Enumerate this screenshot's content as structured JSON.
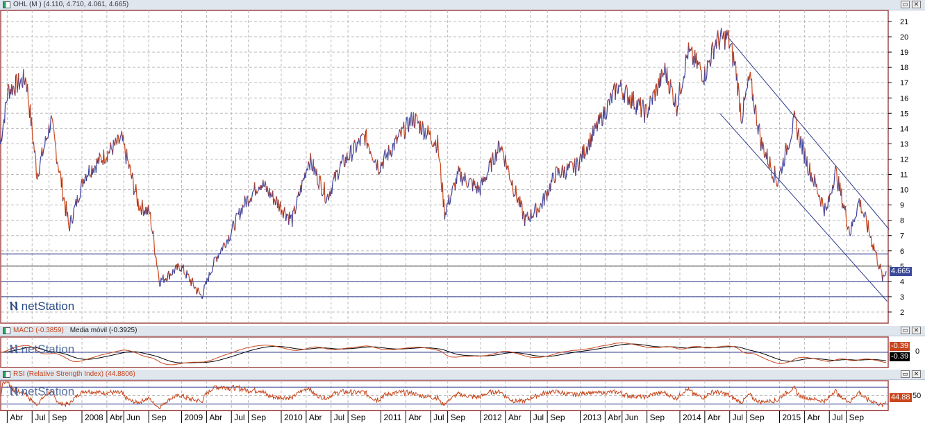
{
  "main_panel": {
    "title": "OHL (M ) (4.110, 4.710, 4.061, 4.665)",
    "last_price": "4.665",
    "y_ticks": [
      "21",
      "20",
      "19",
      "18",
      "17",
      "16",
      "15",
      "14",
      "13",
      "12",
      "11",
      "10",
      "9",
      "8",
      "7",
      "6",
      "5",
      "4",
      "3",
      "2"
    ]
  },
  "macd_panel": {
    "title_macd": "MACD (-0.3859)",
    "separator": " - ",
    "title_ma": "Media móvil (-0.3925)",
    "badge_macd": "-0.39",
    "badge_ma": "-0.39",
    "y_tick": "0"
  },
  "rsi_panel": {
    "title": "RSI (Relative Strength Index) (44.8806)",
    "badge": "44.88",
    "y_tick": "50"
  },
  "watermark": "netStation",
  "x_axis": [
    "Abr",
    "Jul",
    "Sep",
    "2008",
    "Abr",
    "Jun",
    "Sep",
    "2009",
    "Abr",
    "Jul",
    "Sep",
    "2010",
    "Abr",
    "Jul",
    "Sep",
    "2011",
    "Abr",
    "Jul",
    "Sep",
    "2012",
    "Abr",
    "Jul",
    "Sep",
    "2013",
    "Abr",
    "Jun",
    "Sep",
    "2014",
    "Abr",
    "Jul",
    "Sep",
    "2015",
    "Abr",
    "Jul",
    "Sep"
  ],
  "colors": {
    "up": "#3a3f9a",
    "down": "#c8461c",
    "line": "#2e3a8c",
    "border": "#a04848"
  },
  "chart_data": {
    "type": "line",
    "title": "OHL (M)",
    "ylim": [
      2,
      21.5
    ],
    "xlim": [
      2007.18,
      2016.1
    ],
    "x_tick_dates": [
      2007.25,
      2007.5,
      2007.67,
      2008.0,
      2008.25,
      2008.42,
      2008.67,
      2009.0,
      2009.25,
      2009.5,
      2009.67,
      2010.0,
      2010.25,
      2010.5,
      2010.67,
      2011.0,
      2011.25,
      2011.5,
      2011.67,
      2012.0,
      2012.25,
      2012.5,
      2012.67,
      2013.0,
      2013.25,
      2013.42,
      2013.67,
      2014.0,
      2014.25,
      2014.5,
      2014.67,
      2015.0,
      2015.25,
      2015.5,
      2015.67
    ],
    "price_points": [
      [
        2007.18,
        13
      ],
      [
        2007.26,
        16.5
      ],
      [
        2007.44,
        17.3
      ],
      [
        2007.55,
        11
      ],
      [
        2007.69,
        14.5
      ],
      [
        2007.87,
        7.5
      ],
      [
        2008.03,
        11
      ],
      [
        2008.4,
        13.3
      ],
      [
        2008.57,
        9
      ],
      [
        2008.68,
        8.5
      ],
      [
        2008.78,
        4
      ],
      [
        2008.99,
        5
      ],
      [
        2009.2,
        3
      ],
      [
        2009.34,
        5.5
      ],
      [
        2009.48,
        7
      ],
      [
        2009.62,
        9
      ],
      [
        2009.79,
        10.5
      ],
      [
        2010.11,
        8
      ],
      [
        2010.28,
        12
      ],
      [
        2010.46,
        9.5
      ],
      [
        2010.59,
        11.5
      ],
      [
        2010.84,
        13.5
      ],
      [
        2010.98,
        11.5
      ],
      [
        2011.32,
        14.7
      ],
      [
        2011.57,
        13
      ],
      [
        2011.64,
        8.5
      ],
      [
        2011.78,
        11
      ],
      [
        2011.99,
        10
      ],
      [
        2012.2,
        13
      ],
      [
        2012.34,
        10
      ],
      [
        2012.45,
        8
      ],
      [
        2012.61,
        9
      ],
      [
        2012.75,
        11
      ],
      [
        2012.96,
        11.5
      ],
      [
        2013.24,
        15
      ],
      [
        2013.38,
        16.8
      ],
      [
        2013.66,
        15
      ],
      [
        2013.85,
        17.8
      ],
      [
        2013.97,
        15.5
      ],
      [
        2014.08,
        19
      ],
      [
        2014.25,
        17.5
      ],
      [
        2014.36,
        19.7
      ],
      [
        2014.48,
        20
      ],
      [
        2014.56,
        18
      ],
      [
        2014.62,
        14.7
      ],
      [
        2014.7,
        17.3
      ],
      [
        2014.82,
        13
      ],
      [
        2014.98,
        10.5
      ],
      [
        2015.15,
        14.5
      ],
      [
        2015.29,
        11.5
      ],
      [
        2015.47,
        8.5
      ],
      [
        2015.56,
        11.2
      ],
      [
        2015.71,
        7.2
      ],
      [
        2015.8,
        9.3
      ],
      [
        2015.96,
        6
      ],
      [
        2016.04,
        4.1
      ],
      [
        2016.07,
        4.665
      ]
    ],
    "horizontal_lines": [
      5.8,
      5.0,
      4.0,
      3.0
    ],
    "channel_lines": [
      [
        [
          2014.48,
          20
        ],
        [
          2016.1,
          7.4
        ]
      ],
      [
        [
          2014.4,
          15
        ],
        [
          2016.08,
          2.7
        ]
      ]
    ],
    "rsi_levels": [
      70,
      50,
      30
    ]
  }
}
